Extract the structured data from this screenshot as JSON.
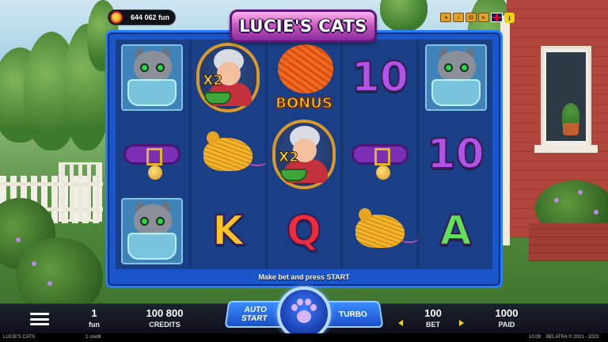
{
  "header": {
    "balance_text": "644 062 fun",
    "game_logo": "LUCIE'S CATS",
    "hud_icons": [
      "settings-icon",
      "sound-icon",
      "paytable-icon",
      "history-icon",
      "uk-flag-icon",
      "info-icon"
    ],
    "info_label": "i"
  },
  "reels": [
    [
      "cat-in-bowl",
      "collar",
      "cat-in-bowl"
    ],
    [
      "granny-x2",
      "mouse",
      "K"
    ],
    [
      "yarn-bonus",
      "granny-x2",
      "Q"
    ],
    [
      "10",
      "collar",
      "mouse"
    ],
    [
      "cat-in-bowl",
      "10",
      "A"
    ]
  ],
  "symbols": {
    "bonus_label": "BONUS",
    "multiplier_label": "X2",
    "ten": "10",
    "k": "K",
    "q": "Q",
    "a": "A"
  },
  "prompt_text": "Make bet and press START",
  "bottom_bar": {
    "lines_value": "1",
    "lines_label": "fun",
    "credits_value": "100 800",
    "credits_label": "CREDITS",
    "auto_start_line1": "AUTO",
    "auto_start_line2": "START",
    "turbo_label": "TURBO",
    "bet_value": "100",
    "bet_label": "BET",
    "paid_value": "1000",
    "paid_label": "PAID"
  },
  "footer": {
    "game_name": "LUCIE'S CATS",
    "credit_text": "1 credit",
    "time": "10:09",
    "copyright": "BELATRA © 2021 - 2023"
  },
  "colors": {
    "frame_blue": "#1a55c9",
    "logo_pink": "#c457b8",
    "accent_yellow": "#f1d21b",
    "ten_purple": "#b153e8",
    "k_yellow": "#f6c428",
    "q_red": "#ef2d3a",
    "a_green": "#63e05a"
  }
}
